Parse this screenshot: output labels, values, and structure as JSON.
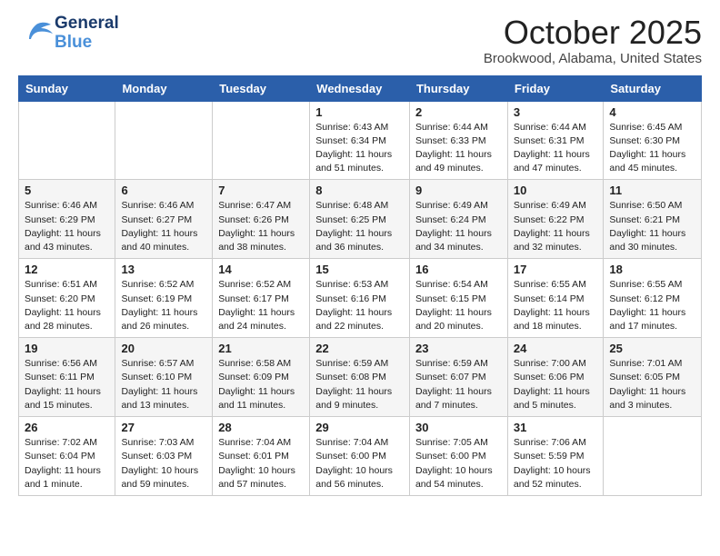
{
  "header": {
    "logo_general": "General",
    "logo_blue": "Blue",
    "month": "October 2025",
    "location": "Brookwood, Alabama, United States"
  },
  "days_of_week": [
    "Sunday",
    "Monday",
    "Tuesday",
    "Wednesday",
    "Thursday",
    "Friday",
    "Saturday"
  ],
  "weeks": [
    [
      {
        "day": "",
        "sunrise": "",
        "sunset": "",
        "daylight": ""
      },
      {
        "day": "",
        "sunrise": "",
        "sunset": "",
        "daylight": ""
      },
      {
        "day": "",
        "sunrise": "",
        "sunset": "",
        "daylight": ""
      },
      {
        "day": "1",
        "sunrise": "Sunrise: 6:43 AM",
        "sunset": "Sunset: 6:34 PM",
        "daylight": "Daylight: 11 hours and 51 minutes."
      },
      {
        "day": "2",
        "sunrise": "Sunrise: 6:44 AM",
        "sunset": "Sunset: 6:33 PM",
        "daylight": "Daylight: 11 hours and 49 minutes."
      },
      {
        "day": "3",
        "sunrise": "Sunrise: 6:44 AM",
        "sunset": "Sunset: 6:31 PM",
        "daylight": "Daylight: 11 hours and 47 minutes."
      },
      {
        "day": "4",
        "sunrise": "Sunrise: 6:45 AM",
        "sunset": "Sunset: 6:30 PM",
        "daylight": "Daylight: 11 hours and 45 minutes."
      }
    ],
    [
      {
        "day": "5",
        "sunrise": "Sunrise: 6:46 AM",
        "sunset": "Sunset: 6:29 PM",
        "daylight": "Daylight: 11 hours and 43 minutes."
      },
      {
        "day": "6",
        "sunrise": "Sunrise: 6:46 AM",
        "sunset": "Sunset: 6:27 PM",
        "daylight": "Daylight: 11 hours and 40 minutes."
      },
      {
        "day": "7",
        "sunrise": "Sunrise: 6:47 AM",
        "sunset": "Sunset: 6:26 PM",
        "daylight": "Daylight: 11 hours and 38 minutes."
      },
      {
        "day": "8",
        "sunrise": "Sunrise: 6:48 AM",
        "sunset": "Sunset: 6:25 PM",
        "daylight": "Daylight: 11 hours and 36 minutes."
      },
      {
        "day": "9",
        "sunrise": "Sunrise: 6:49 AM",
        "sunset": "Sunset: 6:24 PM",
        "daylight": "Daylight: 11 hours and 34 minutes."
      },
      {
        "day": "10",
        "sunrise": "Sunrise: 6:49 AM",
        "sunset": "Sunset: 6:22 PM",
        "daylight": "Daylight: 11 hours and 32 minutes."
      },
      {
        "day": "11",
        "sunrise": "Sunrise: 6:50 AM",
        "sunset": "Sunset: 6:21 PM",
        "daylight": "Daylight: 11 hours and 30 minutes."
      }
    ],
    [
      {
        "day": "12",
        "sunrise": "Sunrise: 6:51 AM",
        "sunset": "Sunset: 6:20 PM",
        "daylight": "Daylight: 11 hours and 28 minutes."
      },
      {
        "day": "13",
        "sunrise": "Sunrise: 6:52 AM",
        "sunset": "Sunset: 6:19 PM",
        "daylight": "Daylight: 11 hours and 26 minutes."
      },
      {
        "day": "14",
        "sunrise": "Sunrise: 6:52 AM",
        "sunset": "Sunset: 6:17 PM",
        "daylight": "Daylight: 11 hours and 24 minutes."
      },
      {
        "day": "15",
        "sunrise": "Sunrise: 6:53 AM",
        "sunset": "Sunset: 6:16 PM",
        "daylight": "Daylight: 11 hours and 22 minutes."
      },
      {
        "day": "16",
        "sunrise": "Sunrise: 6:54 AM",
        "sunset": "Sunset: 6:15 PM",
        "daylight": "Daylight: 11 hours and 20 minutes."
      },
      {
        "day": "17",
        "sunrise": "Sunrise: 6:55 AM",
        "sunset": "Sunset: 6:14 PM",
        "daylight": "Daylight: 11 hours and 18 minutes."
      },
      {
        "day": "18",
        "sunrise": "Sunrise: 6:55 AM",
        "sunset": "Sunset: 6:12 PM",
        "daylight": "Daylight: 11 hours and 17 minutes."
      }
    ],
    [
      {
        "day": "19",
        "sunrise": "Sunrise: 6:56 AM",
        "sunset": "Sunset: 6:11 PM",
        "daylight": "Daylight: 11 hours and 15 minutes."
      },
      {
        "day": "20",
        "sunrise": "Sunrise: 6:57 AM",
        "sunset": "Sunset: 6:10 PM",
        "daylight": "Daylight: 11 hours and 13 minutes."
      },
      {
        "day": "21",
        "sunrise": "Sunrise: 6:58 AM",
        "sunset": "Sunset: 6:09 PM",
        "daylight": "Daylight: 11 hours and 11 minutes."
      },
      {
        "day": "22",
        "sunrise": "Sunrise: 6:59 AM",
        "sunset": "Sunset: 6:08 PM",
        "daylight": "Daylight: 11 hours and 9 minutes."
      },
      {
        "day": "23",
        "sunrise": "Sunrise: 6:59 AM",
        "sunset": "Sunset: 6:07 PM",
        "daylight": "Daylight: 11 hours and 7 minutes."
      },
      {
        "day": "24",
        "sunrise": "Sunrise: 7:00 AM",
        "sunset": "Sunset: 6:06 PM",
        "daylight": "Daylight: 11 hours and 5 minutes."
      },
      {
        "day": "25",
        "sunrise": "Sunrise: 7:01 AM",
        "sunset": "Sunset: 6:05 PM",
        "daylight": "Daylight: 11 hours and 3 minutes."
      }
    ],
    [
      {
        "day": "26",
        "sunrise": "Sunrise: 7:02 AM",
        "sunset": "Sunset: 6:04 PM",
        "daylight": "Daylight: 11 hours and 1 minute."
      },
      {
        "day": "27",
        "sunrise": "Sunrise: 7:03 AM",
        "sunset": "Sunset: 6:03 PM",
        "daylight": "Daylight: 10 hours and 59 minutes."
      },
      {
        "day": "28",
        "sunrise": "Sunrise: 7:04 AM",
        "sunset": "Sunset: 6:01 PM",
        "daylight": "Daylight: 10 hours and 57 minutes."
      },
      {
        "day": "29",
        "sunrise": "Sunrise: 7:04 AM",
        "sunset": "Sunset: 6:00 PM",
        "daylight": "Daylight: 10 hours and 56 minutes."
      },
      {
        "day": "30",
        "sunrise": "Sunrise: 7:05 AM",
        "sunset": "Sunset: 6:00 PM",
        "daylight": "Daylight: 10 hours and 54 minutes."
      },
      {
        "day": "31",
        "sunrise": "Sunrise: 7:06 AM",
        "sunset": "Sunset: 5:59 PM",
        "daylight": "Daylight: 10 hours and 52 minutes."
      },
      {
        "day": "",
        "sunrise": "",
        "sunset": "",
        "daylight": ""
      }
    ]
  ]
}
